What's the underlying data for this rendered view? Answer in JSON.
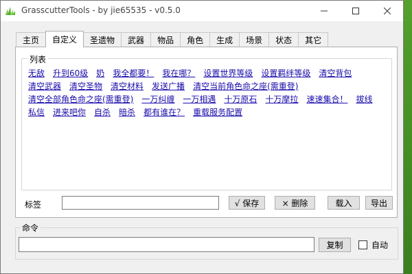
{
  "window": {
    "title": "GrasscutterTools  - by jie65535  - v0.5.0"
  },
  "tabs": [
    {
      "label": "主页"
    },
    {
      "label": "自定义"
    },
    {
      "label": "圣遗物"
    },
    {
      "label": "武器"
    },
    {
      "label": "物品"
    },
    {
      "label": "角色"
    },
    {
      "label": "生成"
    },
    {
      "label": "场景"
    },
    {
      "label": "状态"
    },
    {
      "label": "其它"
    }
  ],
  "list_group": {
    "title": "列表",
    "rows": [
      [
        "无敌",
        "升到60级",
        "奶",
        "我全都要！",
        "我在哪？",
        "设置世界等级",
        "设置羁绊等级",
        "清空背包"
      ],
      [
        "清空武器",
        "清空圣物",
        "清空材料",
        "发送广播",
        "清空当前角色命之座(需重登)"
      ],
      [
        "清空全部角色命之座(需重登)",
        "一万纠缠",
        "一万相遇",
        "十万原石",
        "十万摩拉",
        "速速集合！",
        "拔线"
      ],
      [
        "私信",
        "进来吧你",
        "自杀",
        "暗杀",
        "都有谁在？",
        "重载服务配置"
      ]
    ]
  },
  "tag_row": {
    "label": "标签",
    "value": "",
    "save_label": "√ 保存",
    "delete_label": "× 删除",
    "import_label": "载入",
    "export_label": "导出"
  },
  "command": {
    "title": "命令",
    "value": "",
    "copy_label": "复制",
    "auto_label": "自动",
    "auto_checked": false
  }
}
